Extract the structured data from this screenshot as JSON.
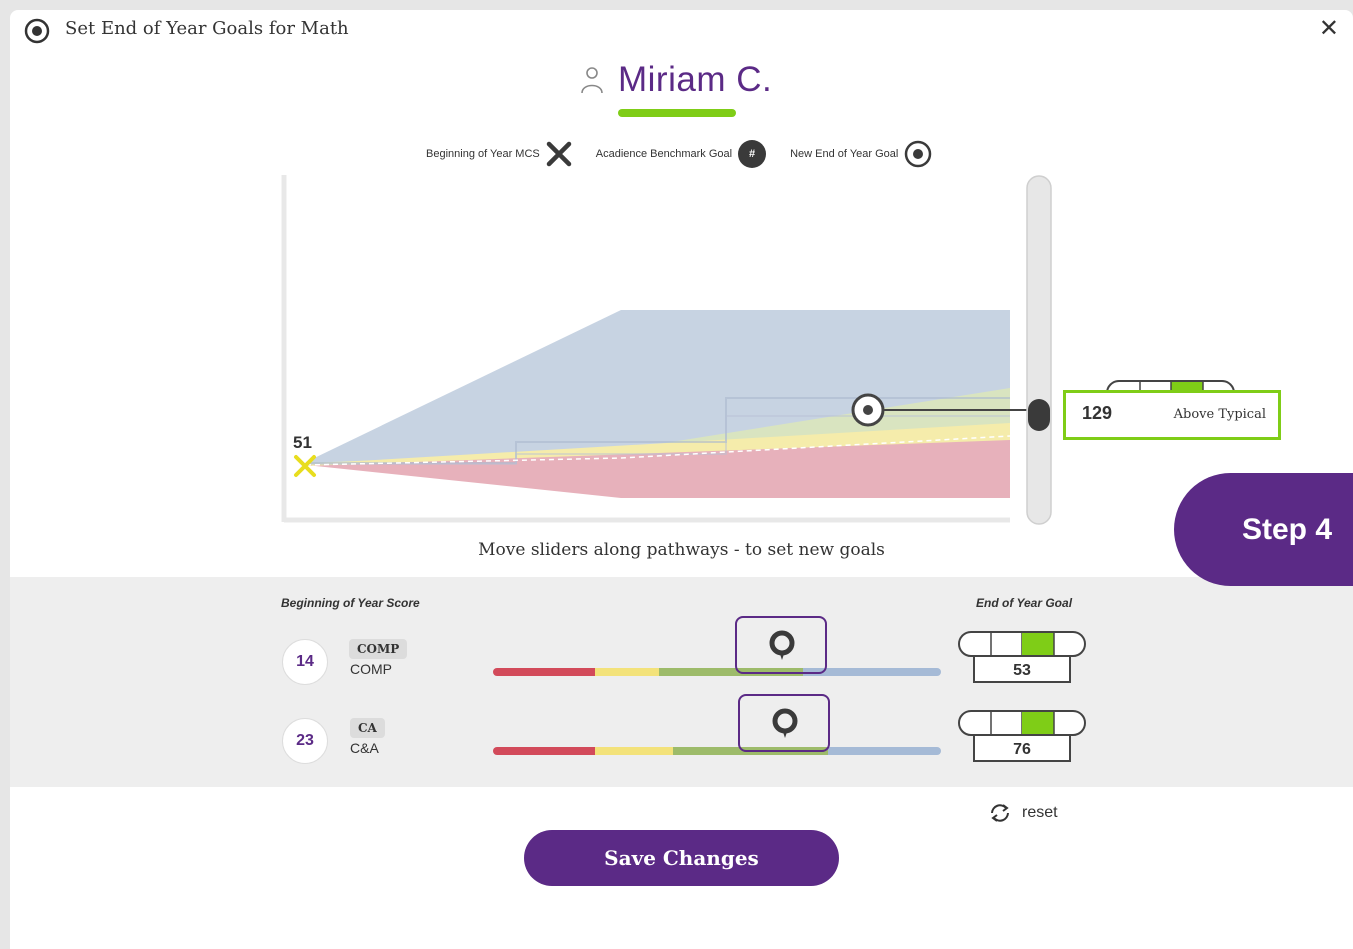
{
  "header": {
    "title": "Set End of Year Goals for Math",
    "close_label": "✕"
  },
  "student": {
    "name": "Miriam C."
  },
  "legend": {
    "boy_mcs": "Beginning of Year MCS",
    "benchmark": "Acadience Benchmark Goal",
    "benchmark_badge": "#",
    "new_goal": "New End of Year Goal"
  },
  "chart": {
    "start_label": "51",
    "goal_value": "129",
    "goal_status": "Above Typical",
    "meter_selected_segment": 3,
    "meter_segments": 4
  },
  "instructions": "Move sliders along pathways - to set new goals",
  "step": "Step 4",
  "columns": {
    "boy_score": "Beginning of Year Score",
    "eoy_goal": "End of Year Goal"
  },
  "rows": [
    {
      "score": "14",
      "pill": "COMP",
      "name": "COMP",
      "goal": "53",
      "slider_fraction": 0.65,
      "meter_selected_segment": 3
    },
    {
      "score": "23",
      "pill": "CA",
      "name": "C&A",
      "goal": "76",
      "slider_fraction": 0.66,
      "meter_selected_segment": 3
    }
  ],
  "colors": {
    "purple": "#5b2a86",
    "green": "#7fcd17",
    "red": "#d24a5a",
    "yellow": "#f3e27a",
    "olive": "#9dbb6a",
    "blue": "#a5bad6"
  },
  "reset_label": "reset",
  "save_label": "Save Changes"
}
